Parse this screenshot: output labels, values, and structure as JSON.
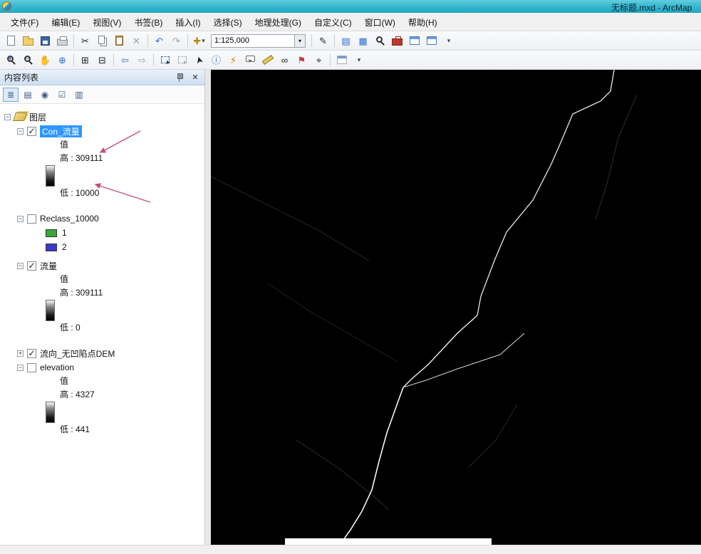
{
  "window": {
    "title": "无标题.mxd - ArcMap"
  },
  "menus": [
    "文件(F)",
    "编辑(E)",
    "视图(V)",
    "书签(B)",
    "插入(I)",
    "选择(S)",
    "地理处理(G)",
    "自定义(C)",
    "窗口(W)",
    "帮助(H)"
  ],
  "standard_toolbar": {
    "scale_value": "1:125,000"
  },
  "toc": {
    "title": "内容列表",
    "root_label": "图层",
    "con": {
      "name": "Con_流量",
      "value_label": "值",
      "high": "高 : 309111",
      "low": "低 : 10000"
    },
    "reclass": {
      "name": "Reclass_10000",
      "class1": "1",
      "class2": "2"
    },
    "flow": {
      "name": "流量",
      "value_label": "值",
      "high": "高 : 309111",
      "low": "低 : 0"
    },
    "flowdir": {
      "name": "流向_无凹陷点DEM"
    },
    "elevation": {
      "name": "elevation",
      "value_label": "值",
      "high": "高 : 4327",
      "low": "低 : 441"
    }
  },
  "icons": {
    "check": "✓",
    "collapse": "−",
    "expand": "+",
    "dropdown": "▾",
    "cut": "✂",
    "delete": "✕",
    "undo": "↶",
    "redo": "↷",
    "add_data": "✚",
    "pencil": "✎",
    "toc_window": "▤",
    "catalog_window": "▦",
    "fixed_zoom_in": "⊞",
    "fixed_zoom_out": "⊟",
    "back": "⇦",
    "forward": "⇨",
    "pointer": "➤",
    "identify": "ⓘ",
    "hyperlink": "⚡",
    "find": "∞",
    "flag": "⚑",
    "goto_xy": "⌖",
    "globe": "⊕",
    "hand": "✋",
    "close": "✕",
    "list_order": "≣",
    "list_source": "▤",
    "list_visibility": "◉",
    "list_selection": "☑",
    "options_menu": "▥"
  },
  "colors": {
    "selection": "#2f96ff",
    "class1": "#39a83b",
    "class2": "#3a3ace",
    "annotation": "#c94f72",
    "titlebar": "#35b7cf"
  }
}
